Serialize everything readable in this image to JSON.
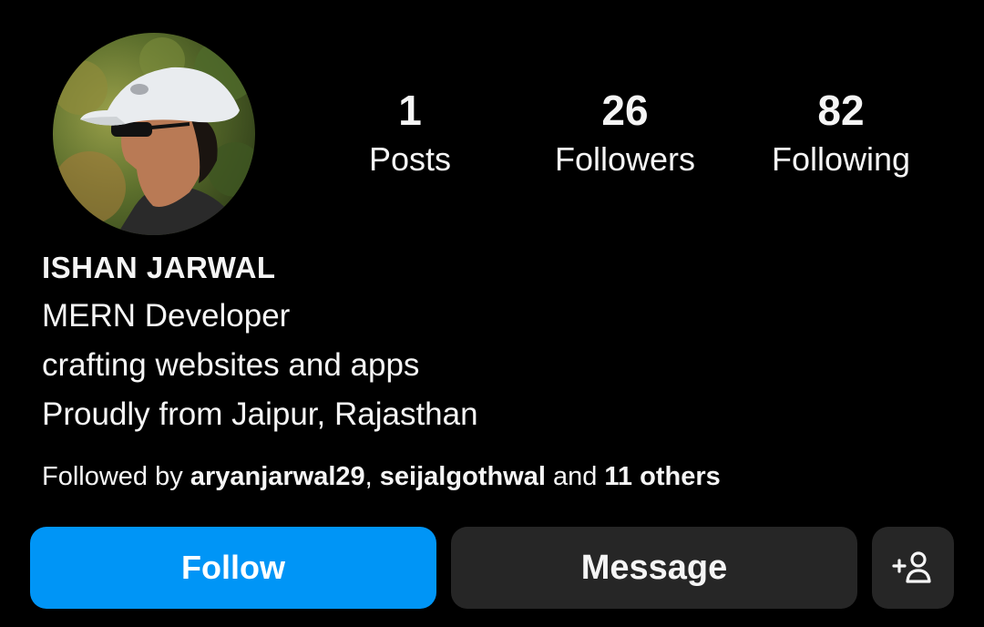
{
  "profile": {
    "avatar_icon": "profile-photo",
    "name": "ISHAN JARWAL",
    "bio_lines": [
      "MERN Developer",
      "crafting websites and apps",
      "Proudly from Jaipur, Rajasthan"
    ]
  },
  "stats": {
    "posts": {
      "value": "1",
      "label": "Posts"
    },
    "followers": {
      "value": "26",
      "label": "Followers"
    },
    "following": {
      "value": "82",
      "label": "Following"
    }
  },
  "followed_by": {
    "prefix": "Followed by ",
    "user1": "aryanjarwal29",
    "separator": ", ",
    "user2": "seijalgothwal",
    "middle": " and ",
    "others": "11 others"
  },
  "actions": {
    "follow_label": "Follow",
    "message_label": "Message",
    "add_user_icon": "add-user-icon"
  },
  "colors": {
    "background": "#000000",
    "follow_button": "#0095f6",
    "secondary_button": "#262626",
    "text": "#f5f5f5"
  }
}
